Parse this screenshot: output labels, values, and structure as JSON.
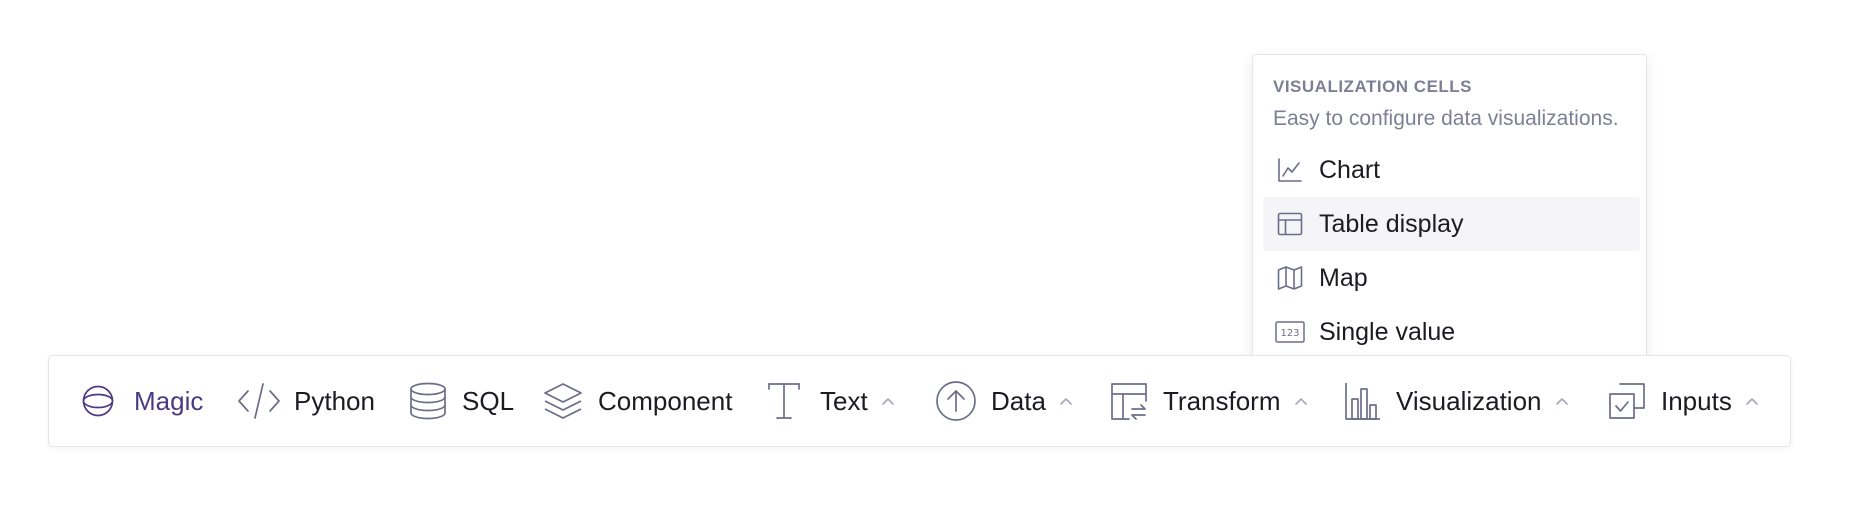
{
  "popover": {
    "heading": "VISUALIZATION CELLS",
    "description": "Easy to configure data visualizations.",
    "items": [
      {
        "label": "Chart",
        "icon": "line-chart-icon",
        "hovered": false
      },
      {
        "label": "Table display",
        "icon": "table-icon",
        "hovered": true
      },
      {
        "label": "Map",
        "icon": "map-icon",
        "hovered": false
      },
      {
        "label": "Single value",
        "icon": "single-value-123-icon",
        "hovered": false
      }
    ]
  },
  "toolbar": {
    "items": [
      {
        "label": "Magic",
        "icon": "magic-orb-icon",
        "has_dropdown": false,
        "accent": "#4a3a84"
      },
      {
        "label": "Python",
        "icon": "code-icon",
        "has_dropdown": false
      },
      {
        "label": "SQL",
        "icon": "database-icon",
        "has_dropdown": false
      },
      {
        "label": "Component",
        "icon": "layers-icon",
        "has_dropdown": false
      },
      {
        "label": "Text",
        "icon": "text-icon",
        "has_dropdown": true
      },
      {
        "label": "Data",
        "icon": "upload-circle-icon",
        "has_dropdown": true
      },
      {
        "label": "Transform",
        "icon": "transform-table-icon",
        "has_dropdown": true
      },
      {
        "label": "Visualization",
        "icon": "bar-chart-icon",
        "has_dropdown": true
      },
      {
        "label": "Inputs",
        "icon": "checkbox-input-icon",
        "has_dropdown": true
      }
    ]
  },
  "colors": {
    "icon_stroke": "#6b6e8a",
    "muted_text": "#7d7f96",
    "accent": "#4a3a84",
    "hover_bg": "#f5f5f8",
    "border": "#e4e4ea"
  }
}
